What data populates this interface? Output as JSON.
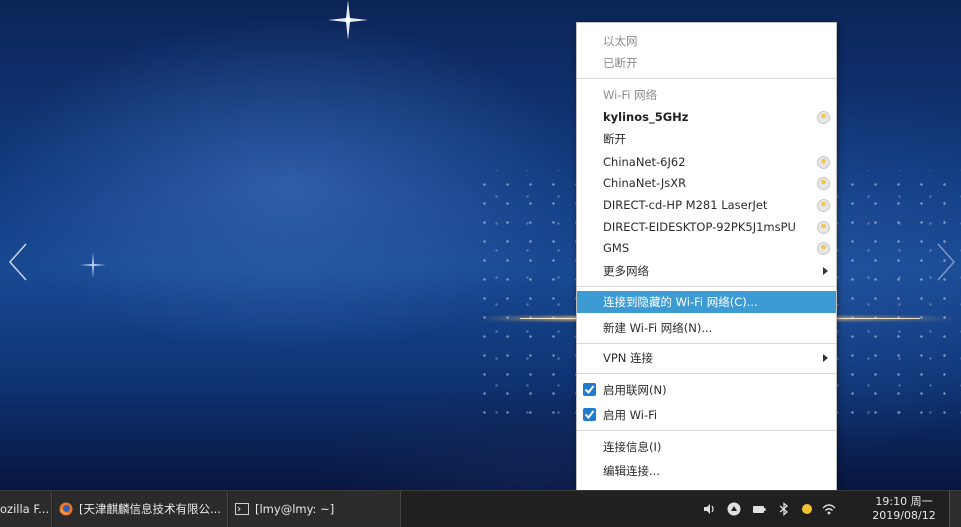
{
  "network_menu": {
    "ethernet_header": "以太网",
    "ethernet_status": "已断开",
    "wifi_header": "Wi-Fi 网络",
    "connected_network": "kylinos_5GHz",
    "disconnect": "断开",
    "networks": [
      "ChinaNet-6J62",
      "ChinaNet-JsXR",
      "DIRECT-cd-HP M281 LaserJet",
      "DIRECT-EIDESKTOP-92PK5J1msPU",
      "GMS"
    ],
    "more_networks": "更多网络",
    "connect_hidden": "连接到隐藏的 Wi-Fi 网络(C)...",
    "new_wifi": "新建 Wi-Fi 网络(N)...",
    "vpn": "VPN 连接",
    "enable_networking": "启用联网(N)",
    "enable_networking_checked": true,
    "enable_wifi": "启用 Wi-Fi",
    "enable_wifi_checked": true,
    "connection_info": "连接信息(I)",
    "edit_connections": "编辑连接..."
  },
  "taskbar": {
    "tasks": [
      "ozilla F...",
      "[天津麒麟信息技术有限公...",
      "[lmy@lmy: ~]"
    ],
    "clock_time": "19:10 周一",
    "clock_date": "2019/08/12"
  },
  "colors": {
    "highlight": "#3d9bd4",
    "taskbar": "#202020",
    "checkbox": "#1f7ad1"
  }
}
